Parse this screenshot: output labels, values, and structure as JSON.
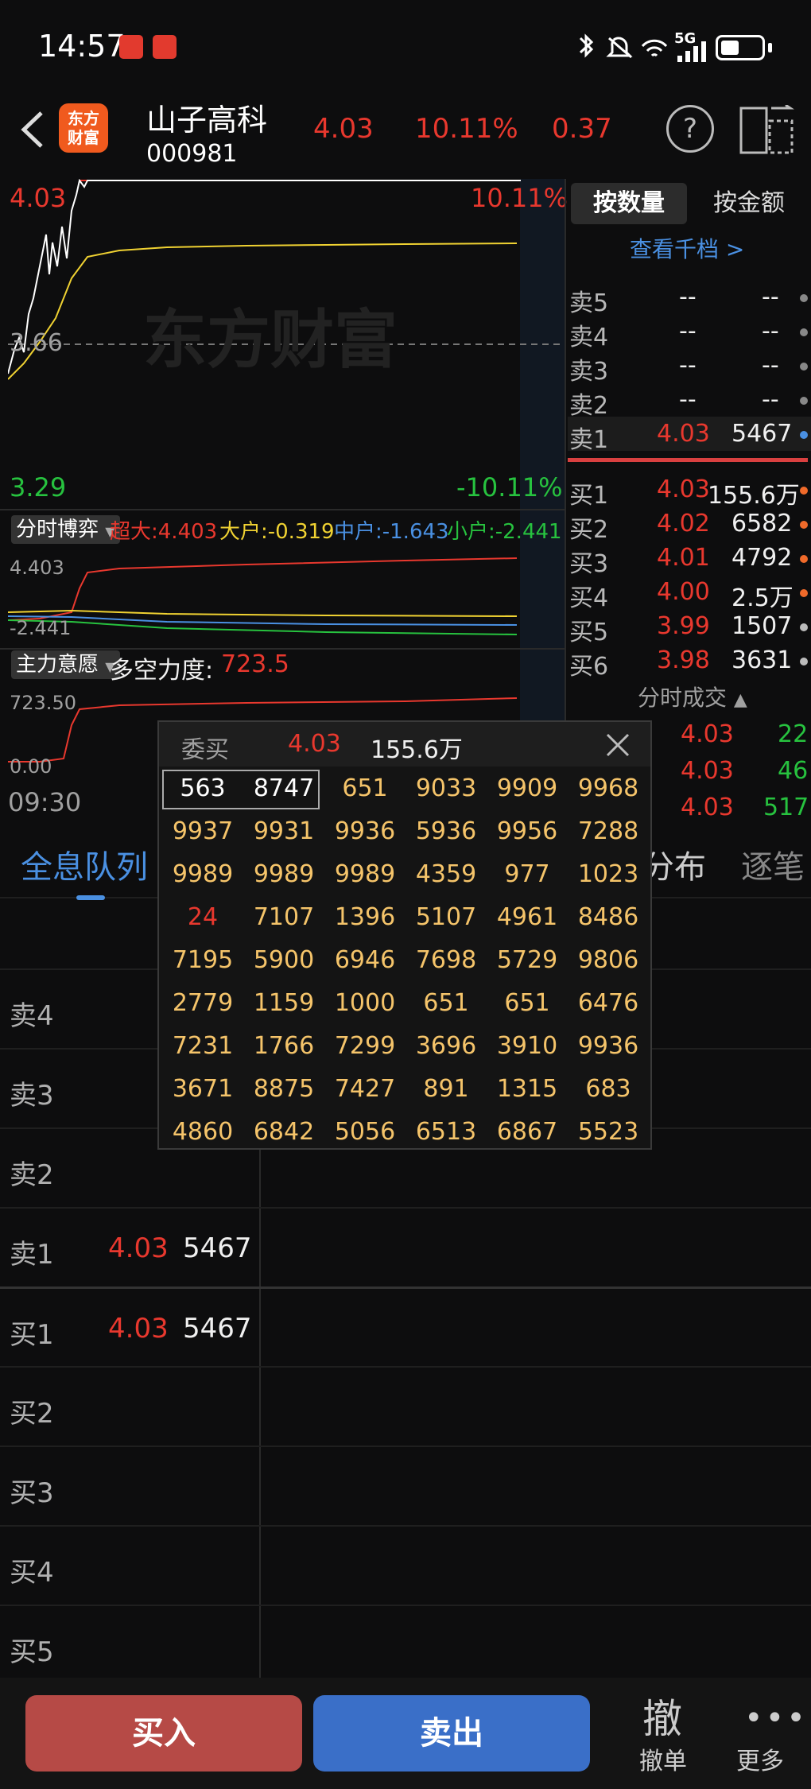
{
  "status_bar": {
    "time": "14:57",
    "network": "5G"
  },
  "header": {
    "logo_line1": "东方",
    "logo_line2": "财富",
    "stock_name": "山子高科",
    "stock_code": "000981",
    "price": "4.03",
    "change_pct": "10.11%",
    "change_amt": "0.37",
    "help_label": "?"
  },
  "main_chart": {
    "high_price": "4.03",
    "high_pct": "10.11%",
    "base_price": "3.66",
    "low_price": "3.29",
    "low_pct": "-10.11%",
    "watermark": "东方财富"
  },
  "sub_chart1": {
    "selector": "分时博弈",
    "super": "超大:4.403",
    "large": "大户:-0.319",
    "mid": "中户:-1.643",
    "small": "小户:-2.441",
    "axis_top": "4.403",
    "axis_bottom": "-2.441"
  },
  "sub_chart2": {
    "selector": "主力意愿",
    "label": "多空力度:",
    "value": "723.5",
    "axis_top": "723.50",
    "axis_bottom": "0.00",
    "time_start": "09:30"
  },
  "order_book": {
    "tab_qty": "按数量",
    "tab_amt": "按金额",
    "view_depth": "查看千档 >",
    "sells": [
      {
        "label": "卖5",
        "price": "--",
        "vol": "--"
      },
      {
        "label": "卖4",
        "price": "--",
        "vol": "--"
      },
      {
        "label": "卖3",
        "price": "--",
        "vol": "--"
      },
      {
        "label": "卖2",
        "price": "--",
        "vol": "--"
      },
      {
        "label": "卖1",
        "price": "4.03",
        "vol": "5467"
      }
    ],
    "buys": [
      {
        "label": "买1",
        "price": "4.03",
        "vol": "155.6万"
      },
      {
        "label": "买2",
        "price": "4.02",
        "vol": "6582"
      },
      {
        "label": "买3",
        "price": "4.01",
        "vol": "4792"
      },
      {
        "label": "买4",
        "price": "4.00",
        "vol": "2.5万"
      },
      {
        "label": "买5",
        "price": "3.99",
        "vol": "1507"
      },
      {
        "label": "买6",
        "price": "3.98",
        "vol": "3631"
      }
    ],
    "trades_title": "分时成交",
    "trades": [
      {
        "price": "4.03",
        "vol": "22"
      },
      {
        "price": "4.03",
        "vol": "46"
      },
      {
        "price": "4.03",
        "vol": "517"
      }
    ]
  },
  "popup": {
    "title": "委买",
    "price": "4.03",
    "total": "155.6万",
    "cells": [
      "563",
      "8747",
      "651",
      "9033",
      "9909",
      "9968",
      "9937",
      "9931",
      "9936",
      "5936",
      "9956",
      "7288",
      "9989",
      "9989",
      "9989",
      "4359",
      "977",
      "1023",
      "24",
      "7107",
      "1396",
      "5107",
      "4961",
      "8486",
      "7195",
      "5900",
      "6946",
      "7698",
      "5729",
      "9806",
      "2779",
      "1159",
      "1000",
      "651",
      "651",
      "6476",
      "7231",
      "1766",
      "7299",
      "3696",
      "3910",
      "9936",
      "3671",
      "8875",
      "7427",
      "891",
      "1315",
      "683",
      "4860",
      "6842",
      "5056",
      "6513",
      "6867",
      "5523"
    ]
  },
  "tabs": {
    "queue": "全息队列",
    "dist": "分布",
    "tick": "逐笔"
  },
  "lower_table": {
    "rows": [
      {
        "label": "卖4",
        "price": "",
        "vol": ""
      },
      {
        "label": "卖3",
        "price": "",
        "vol": ""
      },
      {
        "label": "卖2",
        "price": "",
        "vol": ""
      },
      {
        "label": "卖1",
        "price": "4.03",
        "vol": "5467"
      },
      {
        "label": "买1",
        "price": "4.03",
        "vol": "5467"
      },
      {
        "label": "买2",
        "price": "",
        "vol": ""
      },
      {
        "label": "买3",
        "price": "",
        "vol": ""
      },
      {
        "label": "买4",
        "price": "",
        "vol": ""
      },
      {
        "label": "买5",
        "price": "",
        "vol": ""
      }
    ]
  },
  "bottom": {
    "buy": "买入",
    "sell": "卖出",
    "cancel_icon": "撤",
    "cancel": "撤单",
    "more": "更多"
  },
  "colors": {
    "up": "#e8382e",
    "down": "#27c23f",
    "accent": "#4a90e2",
    "buy_btn": "#b64a46",
    "sell_btn": "#3a6fc8"
  }
}
